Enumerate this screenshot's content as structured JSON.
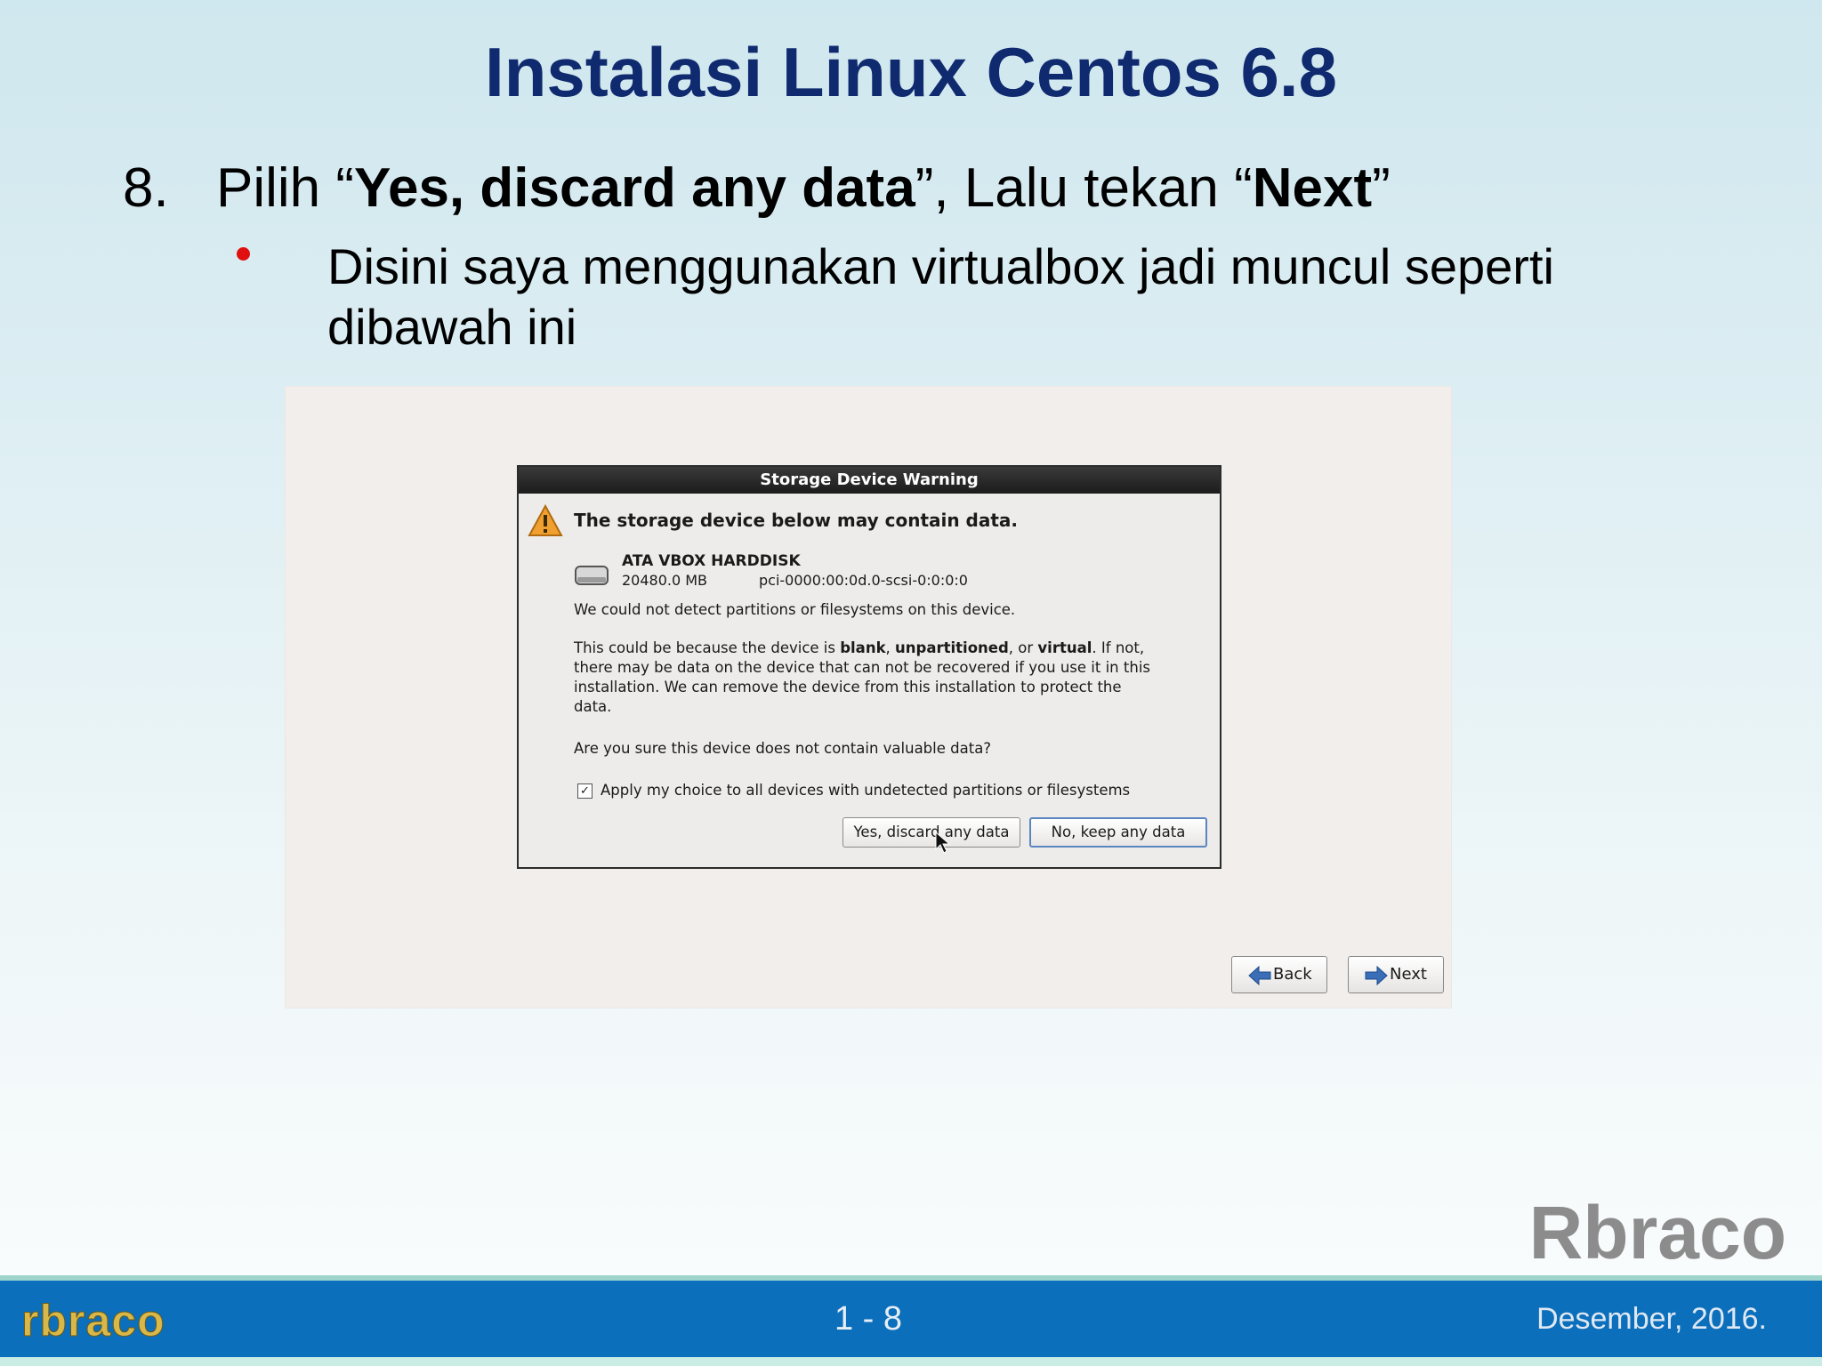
{
  "slide": {
    "title": "Instalasi Linux Centos 6.8",
    "step_number": "8.",
    "step_pre": "Pilih “",
    "step_bold1": "Yes, discard any data",
    "step_mid": "”, Lalu tekan “",
    "step_bold2": "Next",
    "step_post": "”",
    "bullet": "Disini saya menggunakan virtualbox jadi muncul seperti dibawah ini"
  },
  "dialog": {
    "title": "Storage Device Warning",
    "heading": "The storage device below may contain data.",
    "device_name": "ATA VBOX HARDDISK",
    "device_size": "20480.0 MB",
    "device_path": "pci-0000:00:0d.0-scsi-0:0:0:0",
    "para1": "We could not detect partitions or filesystems on this device.",
    "para2_a": "This could be because the device is ",
    "para2_b1": "blank",
    "para2_c": ", ",
    "para2_b2": "unpartitioned",
    "para2_d": ", or ",
    "para2_b3": "virtual",
    "para2_e": ". If not, there may be data on the device that can not be recovered if you use it in this installation. We can remove the device from this installation to protect the data.",
    "para3": "Are you sure this device does not contain valuable data?",
    "checkbox_checked": true,
    "checkbox_label": "Apply my choice to all devices with undetected partitions or filesystems",
    "yes_button": "Yes, discard any data",
    "no_button": "No, keep any data"
  },
  "installer": {
    "back_button": "Back",
    "next_button": "Next"
  },
  "watermark": "Rbraco",
  "footer": {
    "logo": "rbraco",
    "page": "1 - 8",
    "date": "Desember, 2016."
  },
  "colors": {
    "title": "#0f2a6e",
    "bullet": "#e01010",
    "footer_bar": "#0b6fbb",
    "logo": "#d9b84a",
    "arrow_icon": "#3a6fb8",
    "warning_icon": "#f0a030"
  }
}
